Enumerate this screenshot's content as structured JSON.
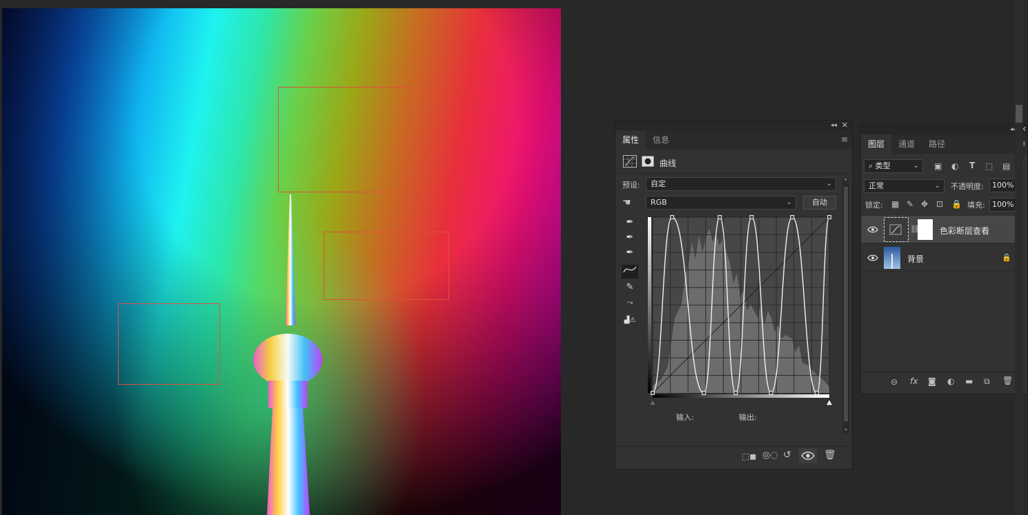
{
  "properties_panel": {
    "tabs": [
      {
        "label": "属性",
        "active": true
      },
      {
        "label": "信息",
        "active": false
      }
    ],
    "adjustment_name": "曲线",
    "preset_label": "预设:",
    "preset_value": "自定",
    "channel_value": "RGB",
    "auto_button": "自动",
    "input_label": "输入:",
    "output_label": "输出:"
  },
  "layers_panel": {
    "tabs": [
      {
        "label": "图层",
        "active": true
      },
      {
        "label": "通道",
        "active": false
      },
      {
        "label": "路径",
        "active": false
      }
    ],
    "filter_kind": "类型",
    "blend_mode": "正常",
    "opacity_label": "不透明度:",
    "opacity_value": "100%",
    "lock_label": "锁定:",
    "fill_label": "填充:",
    "fill_value": "100%",
    "layers": [
      {
        "name": "色彩断层查看",
        "type": "curves-adjustment",
        "visible": true,
        "selected": true,
        "locked": false
      },
      {
        "name": "背景",
        "type": "image",
        "visible": true,
        "selected": false,
        "locked": true
      }
    ]
  },
  "curve": {
    "control_points": [
      [
        0,
        0
      ],
      [
        0.11,
        1
      ],
      [
        0.29,
        0
      ],
      [
        0.38,
        1
      ],
      [
        0.47,
        0
      ],
      [
        0.56,
        1
      ],
      [
        0.67,
        0
      ],
      [
        0.79,
        1
      ],
      [
        0.93,
        0
      ],
      [
        1,
        1
      ]
    ]
  },
  "colors": {
    "panel_bg": "#323232",
    "app_bg": "#282828",
    "selection_rect": "#e0503a",
    "selected_layer": "#474747"
  }
}
